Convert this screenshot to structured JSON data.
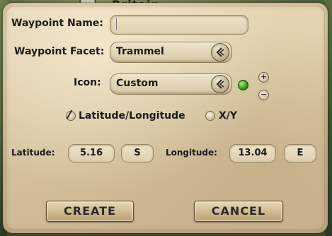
{
  "background": {
    "title": "Britain"
  },
  "form": {
    "waypoint_name_label": "Waypoint Name:",
    "waypoint_name_value": "",
    "facet_label": "Waypoint Facet:",
    "facet_value": "Trammel",
    "icon_label": "Icon:",
    "icon_value": "Custom",
    "icon_color": "#3cb21f",
    "plus_label": "+",
    "minus_label": "−",
    "coord_mode_latlong": "Latitude/Longitude",
    "coord_mode_xy": "X/Y",
    "latitude_label": "Latitude:",
    "latitude_value": "5.16",
    "latitude_dir": "S",
    "longitude_label": "Longitude:",
    "longitude_value": "13.04",
    "longitude_dir": "E"
  },
  "buttons": {
    "create": "CREATE",
    "cancel": "CANCEL"
  }
}
